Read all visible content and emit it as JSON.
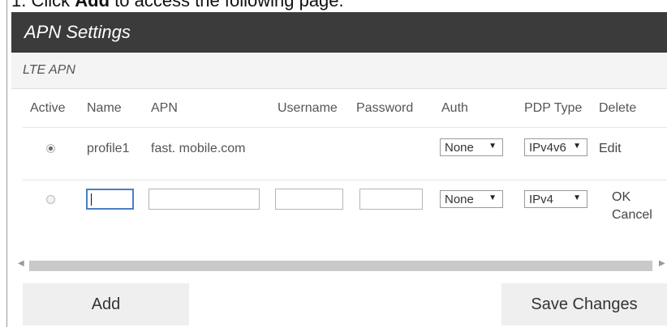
{
  "caption": {
    "prefix": "1. Click ",
    "bold": "Add",
    "suffix": " to access the following page."
  },
  "panel": {
    "title": "APN Settings",
    "subtitle": "LTE APN"
  },
  "table": {
    "headers": [
      "Active",
      "Name",
      "APN",
      "Username",
      "Password",
      "Auth",
      "PDP Type",
      "Delete"
    ],
    "rows": [
      {
        "active": true,
        "name": "profile1",
        "apn": "fast. mobile.com",
        "username": "",
        "password": "",
        "auth": "None",
        "pdp_type": "IPv4v6",
        "action": "Edit"
      }
    ],
    "new_row": {
      "active": false,
      "name": "",
      "apn": "",
      "username": "",
      "password": "",
      "auth": "None",
      "pdp_type": "IPv4",
      "ok_label": "OK",
      "cancel_label": "Cancel"
    }
  },
  "buttons": {
    "add": "Add",
    "save": "Save Changes"
  },
  "icons": {
    "dropdown": "triangle-down-icon",
    "scroll_left": "arrow-left-icon",
    "scroll_right": "arrow-right-icon"
  },
  "colors": {
    "header_bg": "#3b3b3b",
    "subheader_bg": "#f4f4f4",
    "button_bg": "#efefef",
    "focus": "#4a7fc1"
  }
}
